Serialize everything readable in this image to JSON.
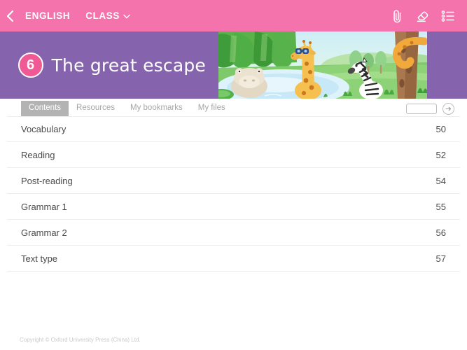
{
  "topbar": {
    "back_icon": "chevron-left-icon",
    "subject": "ENGLISH",
    "class_label": "CLASS",
    "class_chevron": "chevron-down-icon",
    "icons": [
      {
        "name": "paperclip-icon",
        "glyph": "attach"
      },
      {
        "name": "eraser-icon",
        "glyph": "eraser"
      },
      {
        "name": "list-menu-icon",
        "glyph": "list"
      }
    ],
    "background_color": "#f573ac"
  },
  "hero": {
    "unit_number": "6",
    "title": "The great escape",
    "background_color": "#8664ad",
    "badge_color": "#ef5a94",
    "illustration": "jungle-safari-illustration"
  },
  "tabs": [
    {
      "label": "Contents",
      "active": true
    },
    {
      "label": "Resources",
      "active": false
    },
    {
      "label": "My bookmarks",
      "active": false
    },
    {
      "label": "My files",
      "active": false
    }
  ],
  "page_jump": {
    "value": "",
    "placeholder": "",
    "go_icon": "arrow-right-circle-icon"
  },
  "contents": [
    {
      "label": "Vocabulary",
      "page": "50"
    },
    {
      "label": "Reading",
      "page": "52"
    },
    {
      "label": "Post-reading",
      "page": "54"
    },
    {
      "label": "Grammar 1",
      "page": "55"
    },
    {
      "label": "Grammar 2",
      "page": "56"
    },
    {
      "label": "Text type",
      "page": "57"
    }
  ],
  "footer": {
    "copyright": "Copyright © Oxford University Press (China) Ltd."
  }
}
